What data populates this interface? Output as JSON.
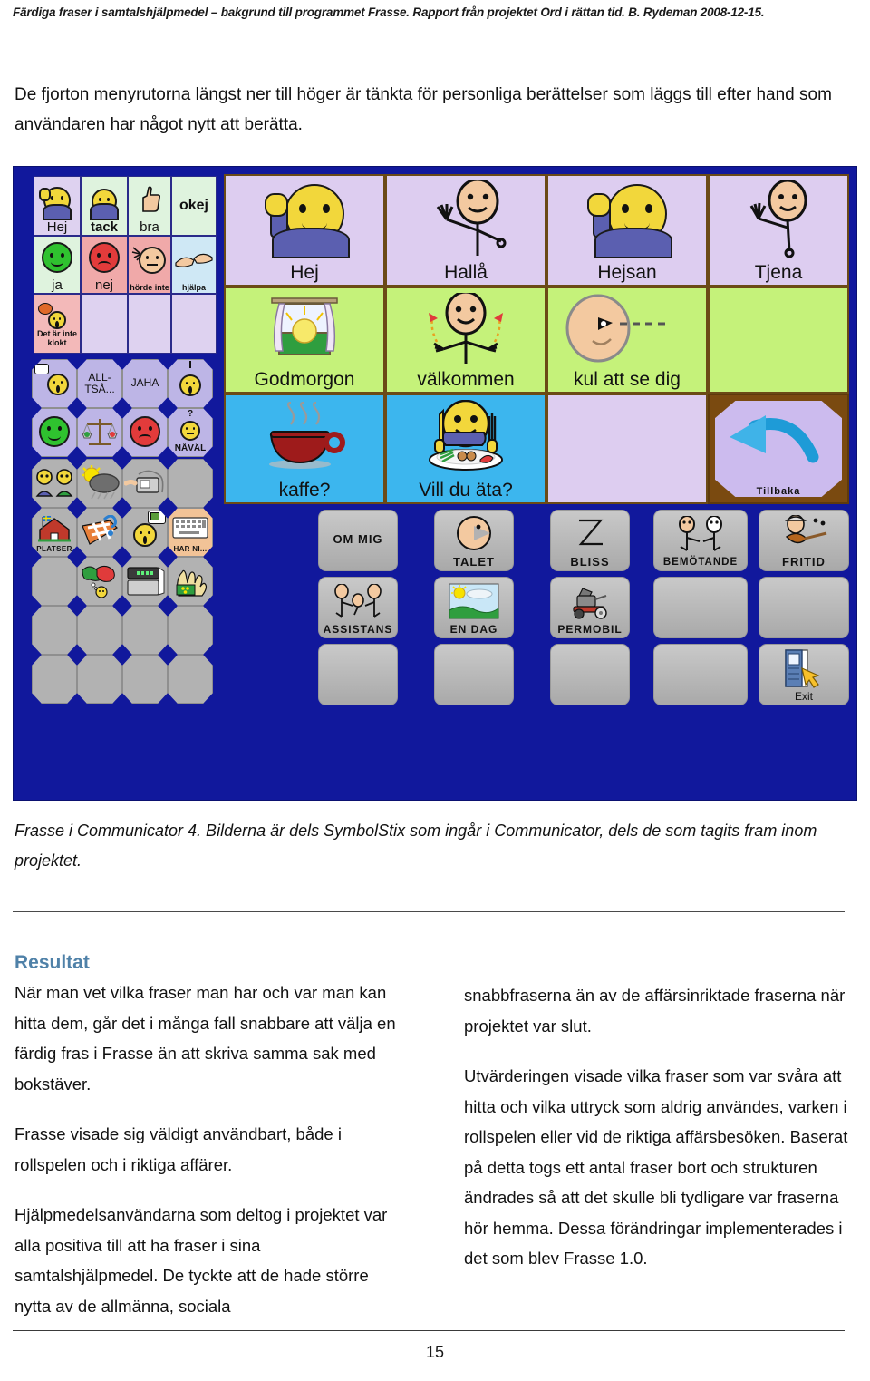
{
  "header": {
    "running_head": "Färdiga fraser i samtalshjälpmedel – bakgrund till programmet Frasse. Rapport från projektet Ord i rättan tid. B. Rydeman 2008-12-15."
  },
  "intro": {
    "paragraph": "De fjorton menyrutorna längst ner till höger är tänkta för personliga berättelser som läggs till efter hand som användaren har något nytt att berätta."
  },
  "figure": {
    "caption": "Frasse i Communicator 4. Bilderna är dels SymbolStix som ingår i Communicator, dels de som tagits fram inom projektet.",
    "background_color": "#11189C",
    "quick_panel": {
      "row1": [
        {
          "label": "Hej",
          "icon": "waving-smiley-icon",
          "bg": "#ded2f0"
        },
        {
          "label": "tack",
          "icon": "smiley-baby-icon",
          "bg": "#dff3de",
          "bold": true
        },
        {
          "label": "bra",
          "icon": "thumbs-up-icon",
          "bg": "#dff3de"
        },
        {
          "label": "okej",
          "icon": "text-only-icon",
          "bg": "#dff3de",
          "bold": true
        }
      ],
      "row2": [
        {
          "label": "ja",
          "icon": "green-smiley-icon",
          "bg": "#dff3de"
        },
        {
          "label": "nej",
          "icon": "red-frowny-icon",
          "bg": "#f0a9a9"
        },
        {
          "label": "hörde inte",
          "icon": "cannot-hear-icon",
          "bg": "#f0a9a9",
          "small": true
        },
        {
          "label": "hjälpa",
          "icon": "helping-hands-icon",
          "bg": "#cfe8f5",
          "small": true
        }
      ],
      "row3": [
        {
          "label": "Det är inte klokt",
          "icon": "surprised-person-icon",
          "bg": "#f3b9b9",
          "small": true
        },
        {
          "label": "",
          "icon": "empty-cell-icon",
          "bg": "#ded2f0"
        },
        {
          "label": "",
          "icon": "empty-cell-icon",
          "bg": "#ded2f0"
        },
        {
          "label": "",
          "icon": "empty-cell-icon",
          "bg": "#ded2f0"
        }
      ]
    },
    "greetings_grid": [
      {
        "label": "Hej",
        "icon": "waving-smiley-icon",
        "bg": "#ddcdf0"
      },
      {
        "label": "Hallå",
        "icon": "waving-stickfigure-icon",
        "bg": "#ddcdf0"
      },
      {
        "label": "Hejsan",
        "icon": "waving-smiley-icon",
        "bg": "#ddcdf0"
      },
      {
        "label": "Tjena",
        "icon": "waving-stickfigure-icon",
        "bg": "#ddcdf0"
      },
      {
        "label": "Godmorgon",
        "icon": "sunrise-window-icon",
        "bg": "#c5f27a"
      },
      {
        "label": "välkommen",
        "icon": "welcoming-figure-icon",
        "bg": "#c5f27a"
      },
      {
        "label": "kul att se dig",
        "icon": "winking-face-icon",
        "bg": "#c5f27a"
      },
      {
        "label": "",
        "icon": "empty-cell-icon",
        "bg": "#c5f27a"
      },
      {
        "label": "kaffe?",
        "icon": "coffee-cup-icon",
        "bg": "#3cb6ee"
      },
      {
        "label": "Vill du äta?",
        "icon": "eating-smiley-icon",
        "bg": "#3cb6ee"
      },
      {
        "label": "",
        "icon": "empty-cell-icon",
        "bg": "#ddcdf0"
      },
      {
        "label": "Tillbaka",
        "icon": "back-arrow-icon",
        "bg": "#ccbbee"
      }
    ],
    "talk_cells": [
      {
        "label": "",
        "icon": "talking-person-icon"
      },
      {
        "label": "ALL-TSÅ...",
        "icon": "text-only-icon"
      },
      {
        "label": "JAHA",
        "icon": "text-only-icon"
      },
      {
        "label": "",
        "icon": "questioning-person-icon"
      },
      {
        "label": "",
        "icon": "green-smiley-icon"
      },
      {
        "label": "",
        "icon": "scales-icon"
      },
      {
        "label": "",
        "icon": "red-frowny-icon"
      },
      {
        "label": "NÅVÄL",
        "icon": "thinking-person-icon"
      }
    ],
    "menu_cells": [
      {
        "label": "",
        "icon": "two-people-talking-icon"
      },
      {
        "label": "",
        "icon": "weather-sun-cloud-icon"
      },
      {
        "label": "",
        "icon": "telephone-icon"
      },
      {
        "label": "",
        "icon": "empty-cell-icon"
      },
      {
        "label": "OM MIG",
        "icon": "text-only-icon"
      },
      {
        "label": "TALET",
        "icon": "speaking-head-icon"
      },
      {
        "label": "BLISS",
        "icon": "bliss-symbol-icon"
      },
      {
        "label": "BEMÖTANDE",
        "icon": "two-stickfigures-icon"
      },
      {
        "label": "FRITID",
        "icon": "guitar-player-icon"
      },
      {
        "label": "PLATSER",
        "icon": "house-flag-icon"
      },
      {
        "label": "",
        "icon": "map-question-icon"
      },
      {
        "label": "",
        "icon": "person-package-icon"
      },
      {
        "label": "HAR NI...",
        "icon": "keyboard-icon"
      },
      {
        "label": "ASSISTANS",
        "icon": "three-stickfigures-icon"
      },
      {
        "label": "EN DAG",
        "icon": "landscape-sun-icon"
      },
      {
        "label": "PERMOBIL",
        "icon": "wheelchair-icon"
      },
      {
        "label": "",
        "icon": "food-thought-icon"
      },
      {
        "label": "",
        "icon": "device-icon"
      },
      {
        "label": "",
        "icon": "money-hand-icon"
      },
      {
        "label": "Exit",
        "icon": "exit-door-icon"
      }
    ]
  },
  "result_section": {
    "heading": "Resultat",
    "left_column": [
      "När man vet vilka fraser man har och var man kan hitta dem, går det i många fall snabbare att välja en färdig fras i Frasse än att skriva samma sak med bokstäver.",
      "Frasse visade sig väldigt användbart, både i rollspelen och i riktiga affärer.",
      "Hjälpmedelsanvändarna som deltog i projektet var alla positiva till att ha fraser i sina samtalshjälpmedel. De tyckte att de hade större nytta av de allmänna, sociala"
    ],
    "right_column": [
      "snabbfraserna än av de affärsinriktade fraserna när projektet var slut.",
      "Utvärderingen visade vilka fraser som var svåra att hitta och vilka uttryck som aldrig användes, varken i rollspelen eller vid de riktiga affärsbesöken. Baserat på detta togs ett antal fraser bort och  strukturen ändrades så att det skulle bli tydligare var fraserna hör hemma. Dessa förändringar implementerades i det som blev Frasse 1.0."
    ],
    "heading_color": "#4F81A8"
  },
  "footer": {
    "page_number": "15"
  }
}
